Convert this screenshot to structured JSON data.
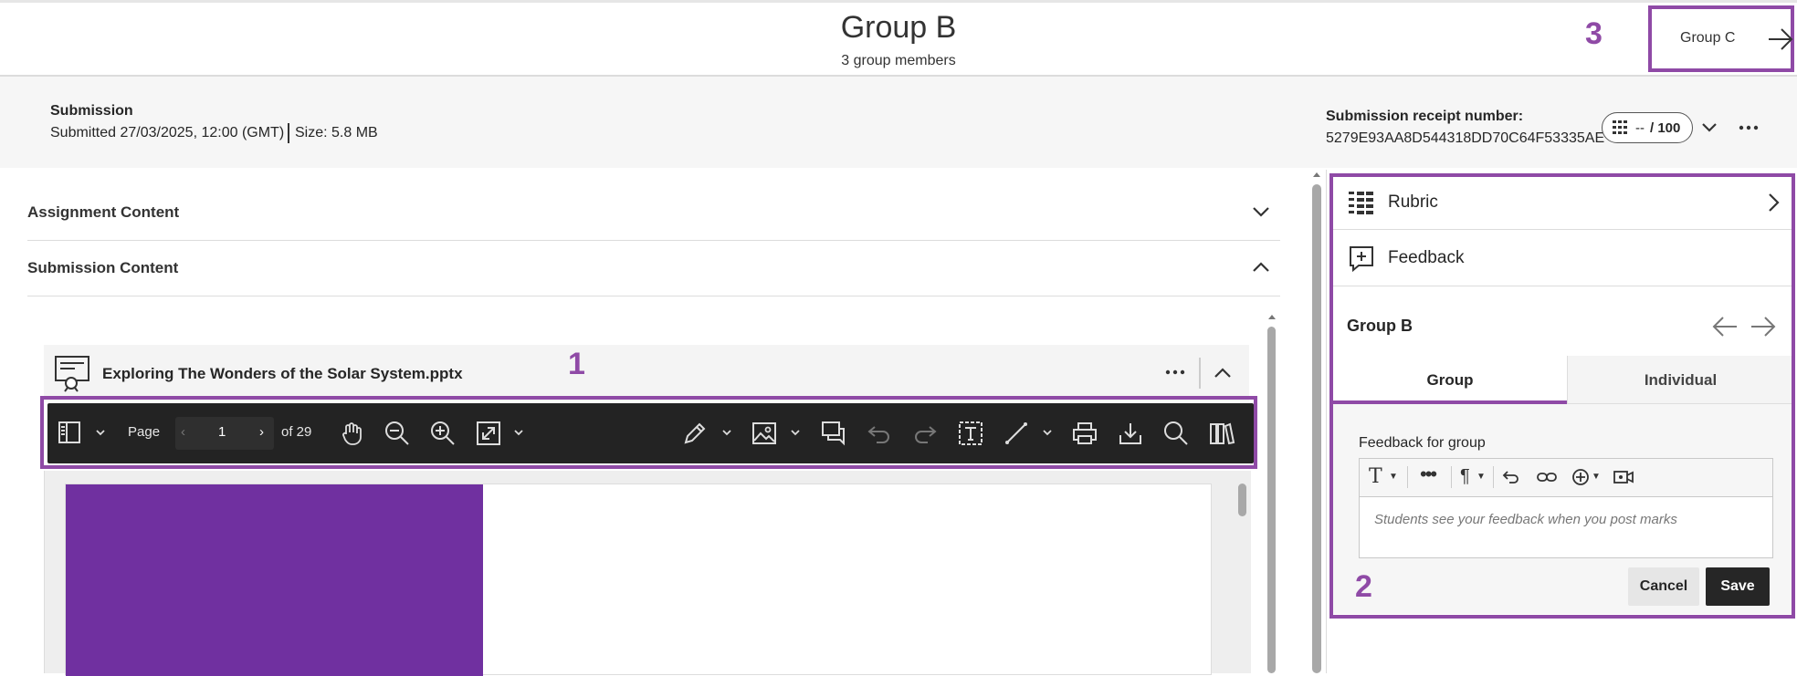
{
  "header": {
    "title": "Group B",
    "subtitle": "3 group members",
    "next_group_label": "Group C"
  },
  "callouts": {
    "one": "1",
    "two": "2",
    "three": "3"
  },
  "submission": {
    "label": "Submission",
    "submitted_text": "Submitted 27/03/2025, 12:00 (GMT)",
    "size_text": "Size: 5.8 MB",
    "receipt_label": "Submission receipt number:",
    "receipt_number": "5279E93AA8D544318DD70C64F53335AE",
    "grade_value": "--",
    "grade_total": "/ 100"
  },
  "accordion": {
    "assignment_label": "Assignment Content",
    "submission_label": "Submission Content"
  },
  "file": {
    "name": "Exploring The Wonders of the Solar System.pptx"
  },
  "viewer": {
    "page_label": "Page",
    "page_number": "1",
    "page_of": "of 29",
    "slide_color": "#7030a0"
  },
  "right_panel": {
    "rubric_label": "Rubric",
    "feedback_label": "Feedback",
    "group_name": "Group B",
    "tab_group": "Group",
    "tab_individual": "Individual",
    "feedback_for_label": "Feedback for group",
    "feedback_placeholder": "Students see your feedback when you post marks",
    "cancel_label": "Cancel",
    "save_label": "Save"
  },
  "colors": {
    "accent": "#8f4aa6",
    "toolbar_bg": "#232323",
    "save_bg": "#262626"
  },
  "icons": [
    "panel-icon",
    "hand-icon",
    "zoom-out-icon",
    "zoom-in-icon",
    "fit-icon",
    "pencil-icon",
    "image-icon",
    "comment-icon",
    "undo-icon",
    "redo-icon",
    "text-box-icon",
    "line-icon",
    "print-icon",
    "download-icon",
    "search-icon",
    "book-icon",
    "rubric-icon",
    "feedback-plus-icon",
    "arrow-left-icon",
    "arrow-right-icon",
    "kebab-icon",
    "chevron-down-icon",
    "chevron-up-icon",
    "presentation-file-icon"
  ]
}
